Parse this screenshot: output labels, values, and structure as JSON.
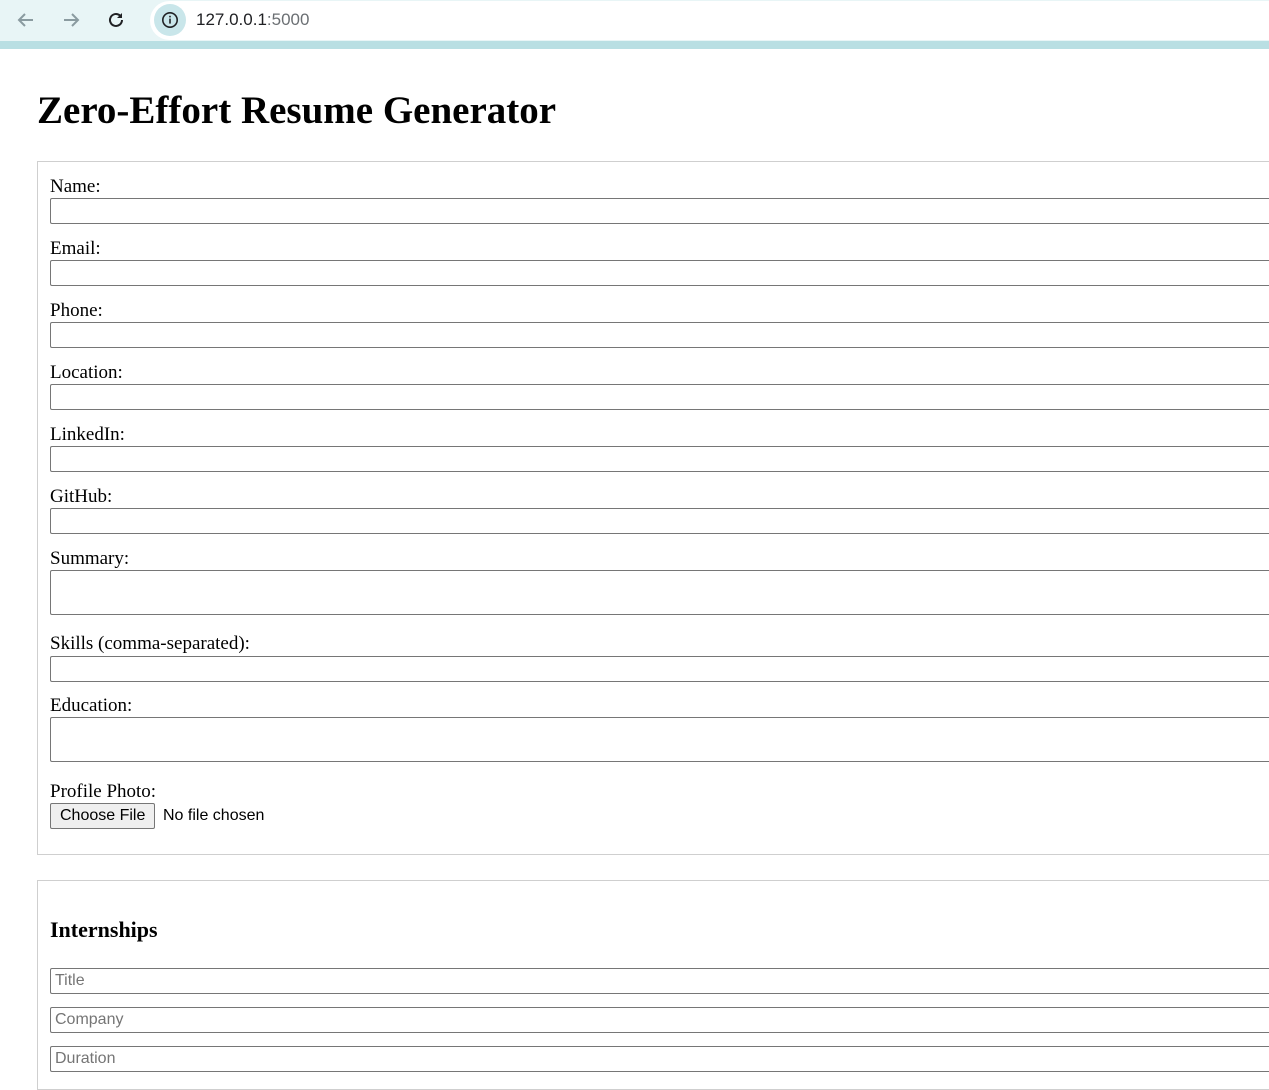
{
  "browser": {
    "url_host": "127.0.0.1",
    "url_port": ":5000",
    "icons": [
      "back-arrow-icon",
      "forward-arrow-icon",
      "reload-icon",
      "info-icon"
    ]
  },
  "page": {
    "title": "Zero-Effort Resume Generator"
  },
  "form": {
    "fields": [
      {
        "label": "Name:",
        "value": ""
      },
      {
        "label": "Email:",
        "value": ""
      },
      {
        "label": "Phone:",
        "value": ""
      },
      {
        "label": "Location:",
        "value": ""
      },
      {
        "label": "LinkedIn:",
        "value": ""
      },
      {
        "label": "GitHub:",
        "value": ""
      },
      {
        "label": "Summary:",
        "value": ""
      },
      {
        "label": "Skills (comma-separated):",
        "value": ""
      },
      {
        "label": "Education:",
        "value": ""
      },
      {
        "label": "Profile Photo:"
      }
    ],
    "file_button_label": "Choose File",
    "file_status": "No file chosen"
  },
  "internships": {
    "heading": "Internships",
    "placeholders": [
      "Title",
      "Company",
      "Duration"
    ]
  }
}
